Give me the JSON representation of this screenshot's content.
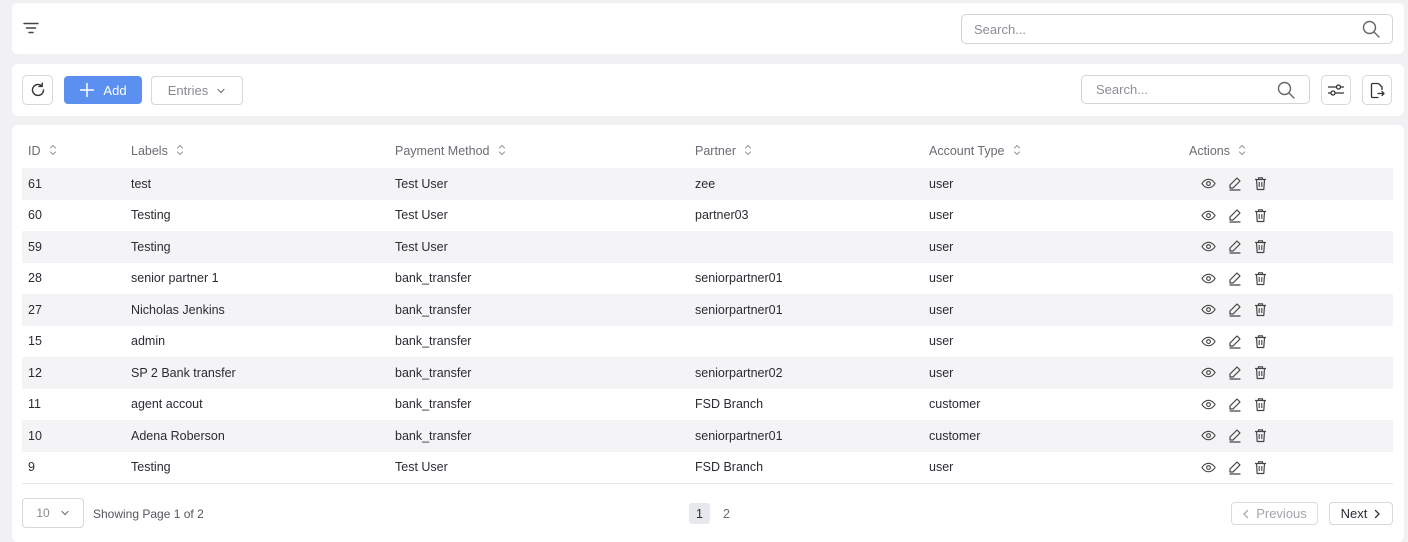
{
  "topbar": {
    "search_placeholder": "Search..."
  },
  "toolbar": {
    "add_label": "Add",
    "entries_label": "Entries",
    "search_placeholder": "Search..."
  },
  "table": {
    "columns": [
      "ID",
      "Labels",
      "Payment Method",
      "Partner",
      "Account Type",
      "Actions"
    ],
    "rows": [
      {
        "id": "61",
        "label": "test",
        "payment_method": "Test User",
        "partner": "zee",
        "account_type": "user"
      },
      {
        "id": "60",
        "label": "Testing",
        "payment_method": "Test User",
        "partner": "partner03",
        "account_type": "user"
      },
      {
        "id": "59",
        "label": "Testing",
        "payment_method": "Test User",
        "partner": "",
        "account_type": "user"
      },
      {
        "id": "28",
        "label": "senior partner 1",
        "payment_method": "bank_transfer",
        "partner": "seniorpartner01",
        "account_type": "user"
      },
      {
        "id": "27",
        "label": "Nicholas Jenkins",
        "payment_method": "bank_transfer",
        "partner": "seniorpartner01",
        "account_type": "user"
      },
      {
        "id": "15",
        "label": "admin",
        "payment_method": "bank_transfer",
        "partner": "",
        "account_type": "user"
      },
      {
        "id": "12",
        "label": "SP 2 Bank transfer",
        "payment_method": "bank_transfer",
        "partner": "seniorpartner02",
        "account_type": "user"
      },
      {
        "id": "11",
        "label": "agent accout",
        "payment_method": "bank_transfer",
        "partner": "FSD Branch",
        "account_type": "customer"
      },
      {
        "id": "10",
        "label": "Adena Roberson",
        "payment_method": "bank_transfer",
        "partner": "seniorpartner01",
        "account_type": "customer"
      },
      {
        "id": "9",
        "label": "Testing",
        "payment_method": "Test User",
        "partner": "FSD Branch",
        "account_type": "user"
      }
    ]
  },
  "footer": {
    "page_size": "10",
    "showing_text": "Showing Page 1 of 2",
    "pages": [
      "1",
      "2"
    ],
    "current_page": "1",
    "previous_label": "Previous",
    "next_label": "Next"
  },
  "colors": {
    "accent": "#5b8ff0",
    "stripe": "#f4f4f6",
    "background": "#f1f1f3"
  }
}
